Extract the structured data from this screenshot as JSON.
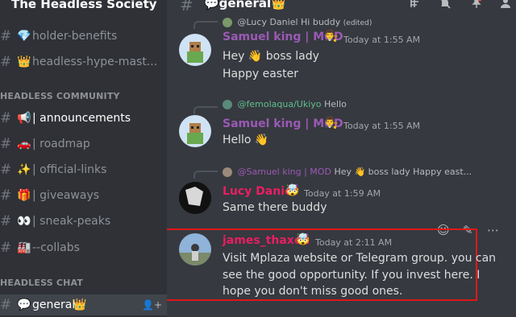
{
  "server": {
    "name": "The Headless Society"
  },
  "sidebar": {
    "channels_top": [
      {
        "emoji": "💎",
        "label": "holder-benefits"
      },
      {
        "emoji": "👑",
        "label": "headless-hype-mast..."
      }
    ],
    "category_community": "HEADLESS COMMUNITY",
    "channels_community": [
      {
        "emoji": "📢",
        "label": "| announcements"
      },
      {
        "emoji": "🚗",
        "label": "| roadmap"
      },
      {
        "emoji": "✨",
        "label": "| official-links"
      },
      {
        "emoji": "🎁",
        "label": "| giveaways"
      },
      {
        "emoji": "👀",
        "label": "| sneak-peaks"
      },
      {
        "emoji": "🏭",
        "label": "--collabs"
      }
    ],
    "category_chat": "HEADLESS CHAT",
    "active_channel": {
      "emoji": "💬",
      "label": "general",
      "suffix": "👑"
    }
  },
  "header": {
    "channel_title": "💬general👑"
  },
  "messages": [
    {
      "reply_to": {
        "name": "@Lucy Daniel",
        "text": "Hi buddy",
        "edited": "(edited)"
      },
      "author": "Samuel king | MOD",
      "author_color": "#9b59b6",
      "badge": "👨‍⚖️",
      "timestamp": "Today at 1:55 AM",
      "lines": [
        "Hey 👋 boss lady",
        "Happy easter"
      ]
    },
    {
      "reply_to": {
        "name": "@femolaqua/Ukiyo",
        "text": "Hello"
      },
      "author": "Samuel king | MOD",
      "author_color": "#9b59b6",
      "badge": "👨‍⚖️",
      "timestamp": "Today at 1:55 AM",
      "lines": [
        "Hello 👋"
      ]
    },
    {
      "reply_to": {
        "name": "@Samuel king | MOD",
        "text": "Hey 👋 boss lady  Happy east..."
      },
      "author": "Lucy Daniel",
      "author_color": "#e91e63",
      "badge": "🤯",
      "timestamp": "Today at 1:59 AM",
      "lines": [
        "Same there buddy"
      ]
    },
    {
      "author": "james_thaxon",
      "author_color": "#e91e63",
      "badge": "🤯",
      "timestamp": "Today at 2:11 AM",
      "lines": [
        "Visit Mplaza website or Telegram group. you can",
        "see the good opportunity. If you invest here.  I",
        "hope you don't miss good ones."
      ]
    }
  ],
  "colors": {
    "sidebar_bg": "#2f3136",
    "main_bg": "#36393f",
    "highlight": "#e01818"
  }
}
